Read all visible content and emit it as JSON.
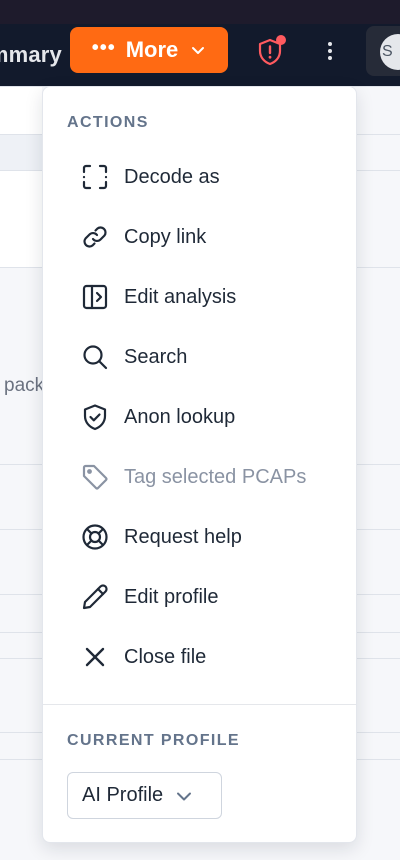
{
  "topbar": {
    "summary_tab_label": "Summary",
    "more_label": "More",
    "avatar_initial": "S"
  },
  "background": {
    "partial_text": "packets"
  },
  "menu": {
    "actions_title": "ACTIONS",
    "items": [
      {
        "label": "Decode as",
        "icon": "decode-icon",
        "enabled": true
      },
      {
        "label": "Copy link",
        "icon": "link-icon",
        "enabled": true
      },
      {
        "label": "Edit analysis",
        "icon": "sidebar-panel-icon",
        "enabled": true
      },
      {
        "label": "Search",
        "icon": "search-icon",
        "enabled": true
      },
      {
        "label": "Anon lookup",
        "icon": "shield-check-icon",
        "enabled": true
      },
      {
        "label": "Tag selected PCAPs",
        "icon": "tag-icon",
        "enabled": false
      },
      {
        "label": "Request help",
        "icon": "lifebuoy-icon",
        "enabled": true
      },
      {
        "label": "Edit profile",
        "icon": "pencil-icon",
        "enabled": true
      },
      {
        "label": "Close file",
        "icon": "close-icon",
        "enabled": true
      }
    ],
    "profile_title": "CURRENT PROFILE",
    "profile_selected": "AI Profile"
  },
  "colors": {
    "accent": "#ff6a13",
    "topbar_bg": "#121a2c",
    "notification_dot": "#ff5a5f"
  }
}
